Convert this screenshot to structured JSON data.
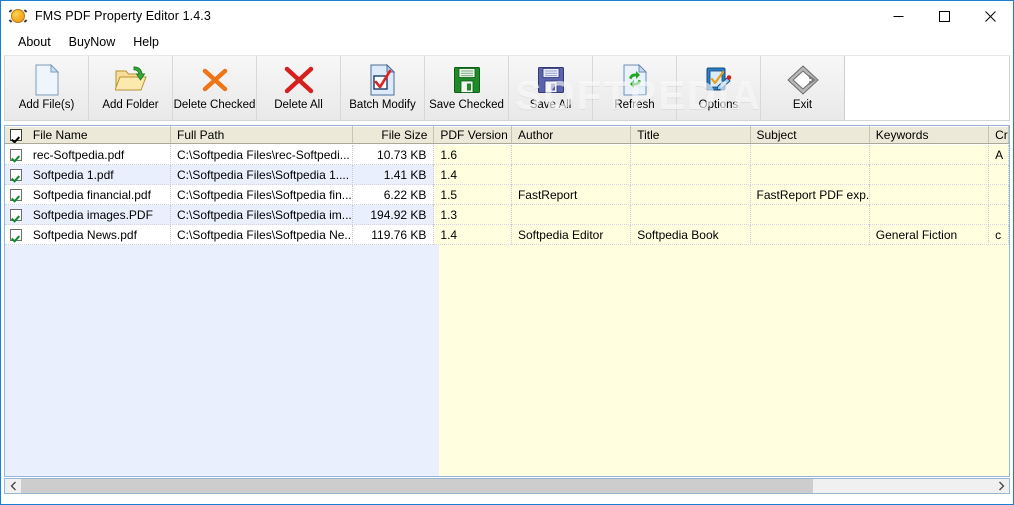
{
  "window": {
    "title": "FMS PDF Property Editor 1.4.3",
    "app_icon": "pdf-app-icon",
    "border_color": "#1a7fd4",
    "buttons": [
      {
        "name": "minimize",
        "glyph": "minimize-icon"
      },
      {
        "name": "maximize",
        "glyph": "maximize-icon"
      },
      {
        "name": "close",
        "glyph": "close-icon"
      }
    ]
  },
  "menubar": {
    "items": [
      {
        "label": "About"
      },
      {
        "label": "BuyNow"
      },
      {
        "label": "Help"
      }
    ]
  },
  "toolbar": {
    "buttons": [
      {
        "label": "Add File(s)",
        "icon": "page-icon"
      },
      {
        "label": "Add Folder",
        "icon": "folder-open-arrow-icon"
      },
      {
        "label": "Delete Checked",
        "icon": "orange-x-icon"
      },
      {
        "label": "Delete All",
        "icon": "red-x-icon"
      },
      {
        "label": "Batch Modify",
        "icon": "page-checkmark-icon"
      },
      {
        "label": "Save Checked",
        "icon": "green-floppy-icon"
      },
      {
        "label": "Save All",
        "icon": "blue-floppy-icon"
      },
      {
        "label": "Refresh",
        "icon": "page-refresh-icon"
      },
      {
        "label": "Options",
        "icon": "clipboard-pencil-icon"
      },
      {
        "label": "Exit",
        "icon": "gray-diamond-icon"
      }
    ]
  },
  "watermark": {
    "text": "SOFTPEDIA"
  },
  "grid": {
    "select_all_checked": true,
    "columns": [
      {
        "key": "check",
        "label": "",
        "width": 22,
        "align": "center"
      },
      {
        "key": "name",
        "label": "File Name",
        "width": 145,
        "align": "left"
      },
      {
        "key": "path",
        "label": "Full Path",
        "width": 183,
        "align": "left"
      },
      {
        "key": "size",
        "label": "File Size",
        "width": 82,
        "align": "right"
      },
      {
        "key": "version",
        "label": "PDF Version",
        "width": 78,
        "align": "left"
      },
      {
        "key": "author",
        "label": "Author",
        "width": 120,
        "align": "left"
      },
      {
        "key": "title",
        "label": "Title",
        "width": 120,
        "align": "left"
      },
      {
        "key": "subject",
        "label": "Subject",
        "width": 120,
        "align": "left"
      },
      {
        "key": "keywords",
        "label": "Keywords",
        "width": 120,
        "align": "left"
      },
      {
        "key": "creator",
        "label": "Cr",
        "width": 20,
        "align": "left"
      }
    ],
    "rows": [
      {
        "checked": true,
        "name": "rec-Softpedia.pdf",
        "path": "C:\\Softpedia Files\\rec-Softpedi...",
        "size": "10.73 KB",
        "version": "1.6",
        "author": "",
        "title": "",
        "subject": "",
        "keywords": "",
        "creator": "A"
      },
      {
        "checked": true,
        "name": "Softpedia 1.pdf",
        "path": "C:\\Softpedia Files\\Softpedia 1....",
        "size": "1.41 KB",
        "version": "1.4",
        "author": "",
        "title": "",
        "subject": "",
        "keywords": "",
        "creator": ""
      },
      {
        "checked": true,
        "name": "Softpedia financial.pdf",
        "path": "C:\\Softpedia Files\\Softpedia fin...",
        "size": "6.22 KB",
        "version": "1.5",
        "author": "FastReport",
        "title": "",
        "subject": "FastReport PDF exp...",
        "keywords": "",
        "creator": ""
      },
      {
        "checked": true,
        "name": "Softpedia images.PDF",
        "path": "C:\\Softpedia Files\\Softpedia im...",
        "size": "194.92 KB",
        "version": "1.3",
        "author": "",
        "title": "",
        "subject": "",
        "keywords": "",
        "creator": ""
      },
      {
        "checked": true,
        "name": "Softpedia News.pdf",
        "path": "C:\\Softpedia Files\\Softpedia Ne...",
        "size": "119.76 KB",
        "version": "1.4",
        "author": "Softpedia Editor",
        "title": "Softpedia Book",
        "subject": "",
        "keywords": "General Fiction",
        "creator": "c"
      }
    ],
    "colors": {
      "header_bg": "#ece9d8",
      "row_even": "#ffffff",
      "row_odd": "#e9effd",
      "editable_bg": "#ffffe0",
      "grid_border": "#9ab6d4"
    }
  },
  "scrollbar": {
    "left_arrow": "chevron-left-icon",
    "right_arrow": "chevron-right-icon",
    "thumb_fraction": 0.815
  }
}
